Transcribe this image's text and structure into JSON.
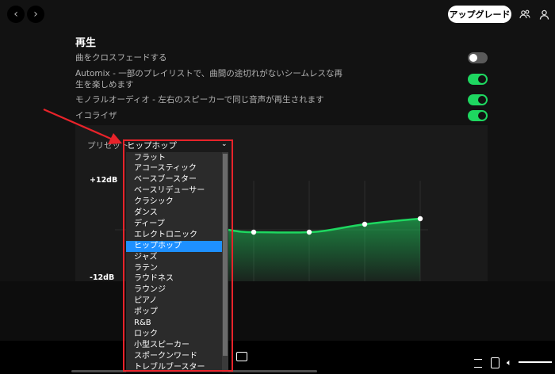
{
  "top_bar": {
    "back_glyph": "‹",
    "forward_glyph": "›",
    "upgrade_label": "アップグレード",
    "icons": [
      "friends-icon",
      "user-icon"
    ]
  },
  "settings": {
    "section_title": "再生",
    "items": [
      {
        "label": "曲をクロスフェードする",
        "enabled": false
      },
      {
        "label": "Automix - 一部のプレイリストで、曲間の途切れがないシームレスな再生を楽しめます",
        "enabled": true
      },
      {
        "label": "モノラルオーディオ - 左右のスピーカーで同じ音声が再生されます",
        "enabled": true
      },
      {
        "label": "イコライザ",
        "enabled": true
      }
    ]
  },
  "equalizer": {
    "preset_label": "プリセット",
    "selected_preset": "ヒップホップ",
    "db_max_label": "+12dB",
    "db_min_label": "-12dB",
    "accent_color": "#1ed760",
    "options": [
      "フラット",
      "アコースティック",
      "ベースブースター",
      "ベースリデューサー",
      "クラシック",
      "ダンス",
      "ディープ",
      "エレクトロニック",
      "ヒップホップ",
      "ジャズ",
      "ラテン",
      "ラウドネス",
      "ラウンジ",
      "ピアノ",
      "ポップ",
      "R&B",
      "ロック",
      "小型スピーカー",
      "スポークンワード",
      "トレブルブースター"
    ],
    "selected_index": 8
  },
  "annotation": {
    "color": "#e8232a"
  }
}
